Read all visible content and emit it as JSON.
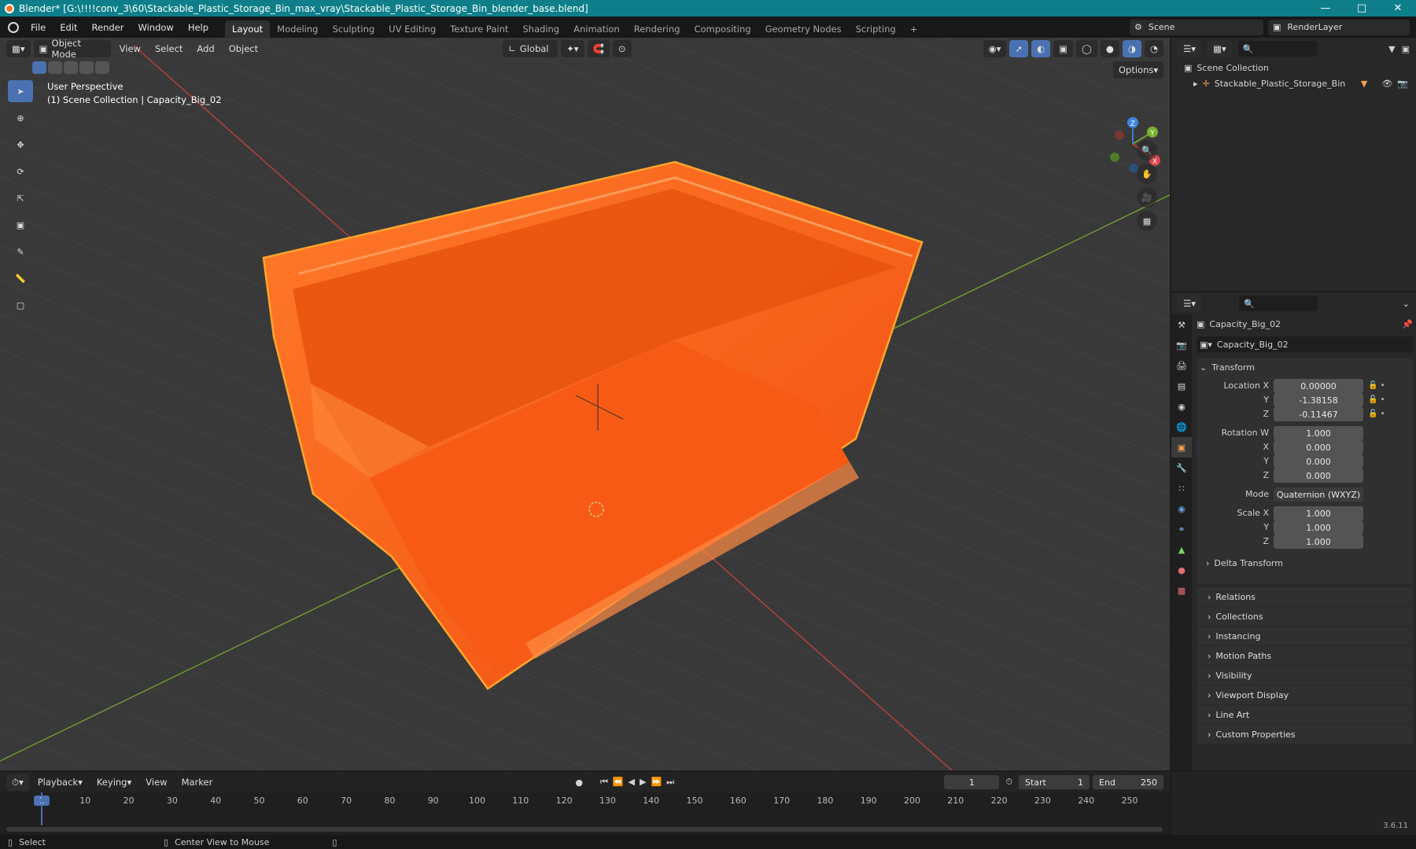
{
  "window": {
    "title": "Blender* [G:\\!!!!conv_3\\60\\Stackable_Plastic_Storage_Bin_max_vray\\Stackable_Plastic_Storage_Bin_blender_base.blend]"
  },
  "menu": {
    "items": [
      "File",
      "Edit",
      "Render",
      "Window",
      "Help"
    ]
  },
  "workspaces": [
    "Layout",
    "Modeling",
    "Sculpting",
    "UV Editing",
    "Texture Paint",
    "Shading",
    "Animation",
    "Rendering",
    "Compositing",
    "Geometry Nodes",
    "Scripting"
  ],
  "scene": {
    "name": "Scene",
    "render_layer": "RenderLayer"
  },
  "viewport": {
    "mode": "Object Mode",
    "menus": [
      "View",
      "Select",
      "Add",
      "Object"
    ],
    "orientation": "Global",
    "options_label": "Options",
    "overlay_line1": "User Perspective",
    "overlay_line2": "(1) Scene Collection | Capacity_Big_02",
    "gizmo_axes": {
      "x": "X",
      "y": "Y",
      "z": "Z"
    },
    "colors": {
      "grid_bg": "#393939",
      "object": "#ff5a10",
      "x_axis": "#c0403f",
      "y_axis": "#6fa02f",
      "selection": "#ffa52e"
    }
  },
  "outliner": {
    "root": "Scene Collection",
    "items": [
      {
        "label": "Stackable_Plastic_Storage_Bin"
      }
    ]
  },
  "properties": {
    "object_name": "Capacity_Big_02",
    "data_name": "Capacity_Big_02",
    "transform_title": "Transform",
    "location": {
      "label": "Location X",
      "x": "0.00000",
      "y": "-1.38158",
      "z": "-0.11467"
    },
    "rotation": {
      "label": "Rotation W",
      "w": "1.000",
      "x": "0.000",
      "y": "0.000",
      "z": "0.000"
    },
    "mode": {
      "label": "Mode",
      "value": "Quaternion (WXYZ)"
    },
    "scale": {
      "label": "Scale X",
      "x": "1.000",
      "y": "1.000",
      "z": "1.000"
    },
    "axis_labels": {
      "y": "Y",
      "z": "Z",
      "x": "X"
    },
    "delta": "Delta Transform",
    "panels": [
      "Relations",
      "Collections",
      "Instancing",
      "Motion Paths",
      "Visibility",
      "Viewport Display",
      "Line Art",
      "Custom Properties"
    ]
  },
  "timeline": {
    "menus": [
      "Playback",
      "Keying",
      "View",
      "Marker"
    ],
    "current_frame": "1",
    "start_label": "Start",
    "start": "1",
    "end_label": "End",
    "end": "250",
    "ticks": [
      "1",
      "10",
      "20",
      "30",
      "40",
      "50",
      "60",
      "70",
      "80",
      "90",
      "100",
      "110",
      "120",
      "130",
      "140",
      "150",
      "160",
      "170",
      "180",
      "190",
      "200",
      "210",
      "220",
      "230",
      "240",
      "250"
    ]
  },
  "status": {
    "select": "Select",
    "center": "Center View to Mouse",
    "version": "3.6.11"
  }
}
